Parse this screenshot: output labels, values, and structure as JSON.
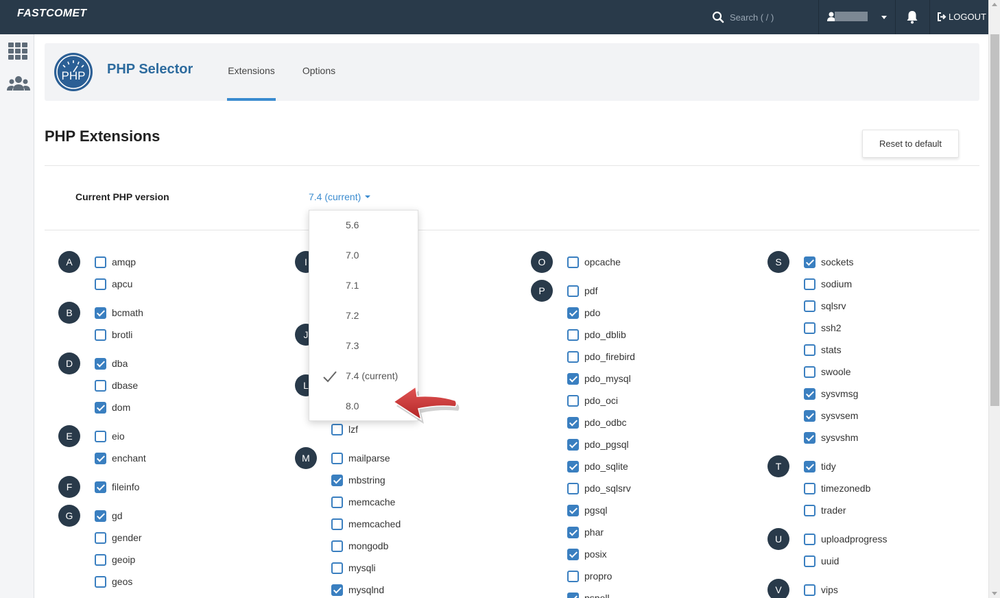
{
  "topbar": {
    "logo": "FASTCOMET",
    "search_placeholder": "Search ( / )",
    "logout": "LOGOUT"
  },
  "app": {
    "logo_text": "PHP",
    "title": "PHP Selector",
    "tabs": [
      "Extensions",
      "Options"
    ],
    "active_tab": "Extensions"
  },
  "content": {
    "title": "PHP Extensions",
    "reset_label": "Reset to default",
    "version_label": "Current PHP version",
    "version_value": "7.4 (current)"
  },
  "dropdown": {
    "options": [
      "5.6",
      "7.0",
      "7.1",
      "7.2",
      "7.3",
      "7.4 (current)",
      "8.0"
    ],
    "selected": "7.4 (current)"
  },
  "groups": {
    "A": "A",
    "B": "B",
    "D": "D",
    "E": "E",
    "F": "F",
    "G": "G",
    "I": "I",
    "J": "J",
    "L": "L",
    "M": "M",
    "O": "O",
    "P": "P",
    "S": "S",
    "T": "T",
    "U": "U",
    "V": "V"
  },
  "extensions": {
    "amqp": "amqp",
    "apcu": "apcu",
    "bcmath": "bcmath",
    "brotli": "brotli",
    "dba": "dba",
    "dbase": "dbase",
    "dom": "dom",
    "eio": "eio",
    "enchant": "enchant",
    "fileinfo": "fileinfo",
    "gd": "gd",
    "gender": "gender",
    "geoip": "geoip",
    "geos": "geos",
    "lzf": "lzf",
    "mailparse": "mailparse",
    "mbstring": "mbstring",
    "memcache": "memcache",
    "memcached": "memcached",
    "mongodb": "mongodb",
    "mysqli": "mysqli",
    "mysqlnd": "mysqlnd",
    "opcache": "opcache",
    "pdf": "pdf",
    "pdo": "pdo",
    "pdo_dblib": "pdo_dblib",
    "pdo_firebird": "pdo_firebird",
    "pdo_mysql": "pdo_mysql",
    "pdo_oci": "pdo_oci",
    "pdo_odbc": "pdo_odbc",
    "pdo_pgsql": "pdo_pgsql",
    "pdo_sqlite": "pdo_sqlite",
    "pdo_sqlsrv": "pdo_sqlsrv",
    "pgsql": "pgsql",
    "phar": "phar",
    "posix": "posix",
    "propro": "propro",
    "pspell": "pspell",
    "sockets": "sockets",
    "sodium": "sodium",
    "sqlsrv": "sqlsrv",
    "ssh2": "ssh2",
    "stats": "stats",
    "swoole": "swoole",
    "sysvmsg": "sysvmsg",
    "sysvsem": "sysvsem",
    "sysvshm": "sysvshm",
    "tidy": "tidy",
    "timezonedb": "timezonedb",
    "trader": "trader",
    "uploadprogress": "uploadprogress",
    "uuid": "uuid",
    "vips": "vips"
  },
  "enabled": [
    "bcmath",
    "dba",
    "dom",
    "enchant",
    "fileinfo",
    "gd",
    "mbstring",
    "mysqlnd",
    "pdo",
    "pdo_mysql",
    "pdo_odbc",
    "pdo_pgsql",
    "pdo_sqlite",
    "pgsql",
    "phar",
    "posix",
    "pspell",
    "sockets",
    "sysvmsg",
    "sysvsem",
    "sysvshm",
    "tidy"
  ],
  "colors": {
    "topbar": "#293a4a",
    "accent": "#3a8bcf",
    "checkbox": "#3a7fc0",
    "badge": "#293a4a",
    "arrow": "#c62f2f"
  }
}
